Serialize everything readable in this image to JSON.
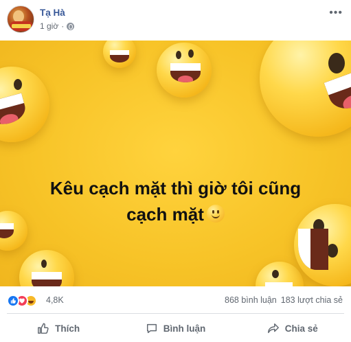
{
  "post": {
    "author": "Tạ Hà",
    "time": "1 giờ",
    "separator": "·",
    "more_icon": "more-horizontal-icon",
    "privacy_icon": "globe-icon"
  },
  "image": {
    "caption_line1": "Kêu cạch mặt thì giờ tôi cũng",
    "caption_line2": "cạch mặt",
    "background_color": "#f7c327"
  },
  "reactions": {
    "types": [
      "like",
      "love",
      "haha"
    ],
    "count": "4,8K",
    "comments": "868 bình luận",
    "shares": "183 lượt chia sẻ"
  },
  "actions": {
    "like": "Thích",
    "comment": "Bình luận",
    "share": "Chia sẻ"
  },
  "colors": {
    "author_link": "#385898",
    "like_blue": "#1877f2",
    "love_red": "#f33e58",
    "haha_yellow": "#f7b928"
  }
}
